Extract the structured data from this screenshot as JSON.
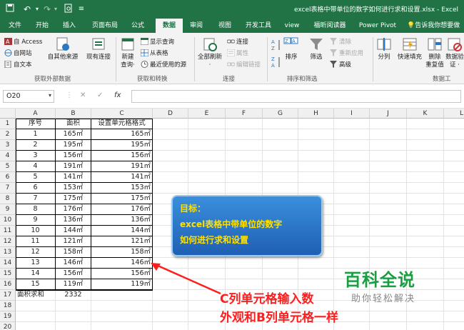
{
  "titlebar": {
    "title": "excel表格中带单位的数字如何进行求和设置.xlsx - Excel",
    "save_icon": "save-icon",
    "undo_icon": "undo-icon",
    "redo_icon": "redo-icon",
    "preview_icon": "print-preview-icon",
    "customize_icon": "customize-quick-access-icon"
  },
  "tabs": [
    "文件",
    "开始",
    "插入",
    "页面布局",
    "公式",
    "数据",
    "审阅",
    "视图",
    "开发工具",
    "view",
    "福昕阅读器",
    "Power Pivot"
  ],
  "active_tab": "数据",
  "tell_me": "告诉我你想要做",
  "ribbon": {
    "get_external": {
      "access": "自 Access",
      "web": "自网站",
      "text": "自文本",
      "other": "自其他来源",
      "existing": "现有连接",
      "label": "获取外部数据"
    },
    "get_transform": {
      "new_query_1": "新建",
      "new_query_2": "查询·",
      "show_queries": "显示查询",
      "from_table": "从表格",
      "recent_sources": "最近使用的源",
      "label": "获取和转换"
    },
    "connections": {
      "refresh_all_1": "全部刷新",
      "refresh_all_2": "·",
      "connections": "连接",
      "properties": "属性",
      "edit_links": "编辑链接",
      "label": "连接"
    },
    "sort_filter": {
      "sort": "排序",
      "filter": "筛选",
      "clear": "清除",
      "reapply": "重新应用",
      "advanced": "高级",
      "label": "排序和筛选"
    },
    "data_tools": {
      "split": "分列",
      "flash_fill": "快速填充",
      "remove_dup_1": "删除",
      "remove_dup_2": "重复值",
      "validation_1": "数据验",
      "validation_2": "证 ·",
      "label": "数据工"
    }
  },
  "formula_bar": {
    "name_box": "O20",
    "cancel": "✕",
    "enter": "✓",
    "fx": "fx",
    "formula": ""
  },
  "columns": [
    "A",
    "B",
    "C",
    "D",
    "E",
    "F",
    "G",
    "H",
    "I",
    "J",
    "K",
    "L"
  ],
  "rows": [
    [
      "序号",
      "面积",
      "设置单元格格式"
    ],
    [
      "1",
      "165㎡",
      "165㎡"
    ],
    [
      "2",
      "195㎡",
      "195㎡"
    ],
    [
      "3",
      "156㎡",
      "156㎡"
    ],
    [
      "4",
      "191㎡",
      "191㎡"
    ],
    [
      "5",
      "141㎡",
      "141㎡"
    ],
    [
      "6",
      "153㎡",
      "153㎡"
    ],
    [
      "7",
      "175㎡",
      "175㎡"
    ],
    [
      "8",
      "176㎡",
      "176㎡"
    ],
    [
      "9",
      "136㎡",
      "136㎡"
    ],
    [
      "10",
      "144㎡",
      "144㎡"
    ],
    [
      "11",
      "121㎡",
      "121㎡"
    ],
    [
      "12",
      "158㎡",
      "158㎡"
    ],
    [
      "13",
      "146㎡",
      "146㎡"
    ],
    [
      "14",
      "156㎡",
      "156㎡"
    ],
    [
      "15",
      "119㎡",
      "119㎡"
    ],
    [
      "面积求和",
      "2332",
      ""
    ],
    [
      "",
      "",
      ""
    ],
    [
      "",
      "",
      ""
    ],
    [
      "",
      "",
      ""
    ],
    [
      "",
      "",
      ""
    ]
  ],
  "callout": {
    "line1": "目标：",
    "line2": "excel表格中带单位的数字",
    "line3": "如何进行求和设置"
  },
  "note": {
    "line1": "C列单元格输入数",
    "line2": "外观和B列单元格一样"
  },
  "watermark": {
    "brand": "百科全说",
    "slogan": "助你轻松解决"
  },
  "colors": {
    "excel_green": "#217346",
    "annotation_red": "#ff1d1d",
    "callout_blue": "#2a76cc",
    "callout_text": "#ffe100",
    "watermark_green": "#1a9e41"
  }
}
